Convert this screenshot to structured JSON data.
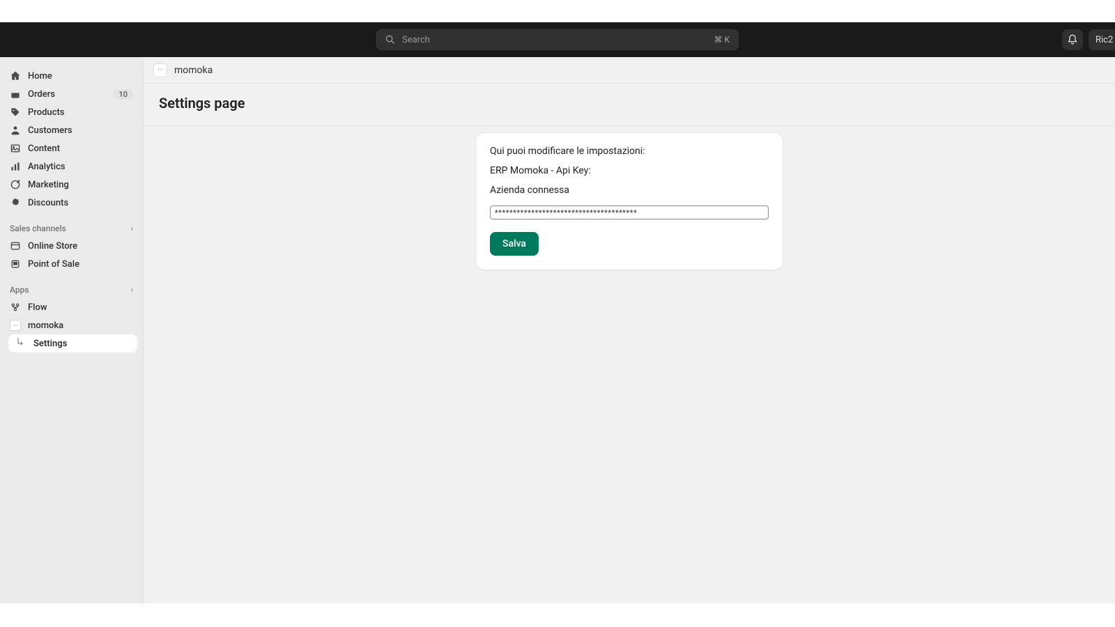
{
  "topbar": {
    "search_placeholder": "Search",
    "shortcut": "⌘ K",
    "user_label": "Ric2"
  },
  "sidebar": {
    "items": [
      {
        "label": "Home"
      },
      {
        "label": "Orders",
        "badge": "10"
      },
      {
        "label": "Products"
      },
      {
        "label": "Customers"
      },
      {
        "label": "Content"
      },
      {
        "label": "Analytics"
      },
      {
        "label": "Marketing"
      },
      {
        "label": "Discounts"
      }
    ],
    "sales_header": "Sales channels",
    "sales": [
      {
        "label": "Online Store"
      },
      {
        "label": "Point of Sale"
      }
    ],
    "apps_header": "Apps",
    "apps": [
      {
        "label": "Flow"
      },
      {
        "label": "momoka"
      }
    ],
    "sub_settings": "Settings"
  },
  "content": {
    "crumb": "momoka",
    "page_title": "Settings page",
    "card": {
      "intro": "Qui puoi modificare le impostazioni:",
      "api_label": "ERP Momoka - Api Key:",
      "company_label": "Azienda connessa",
      "api_value": "***************************************",
      "save_label": "Salva"
    }
  }
}
